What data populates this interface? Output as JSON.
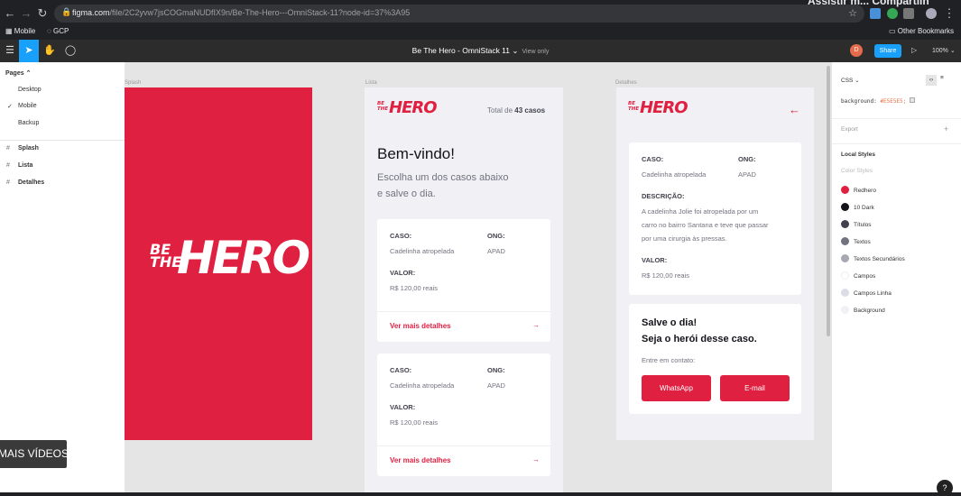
{
  "browser": {
    "url_host": "figma.com",
    "url_path": "/file/2C2yvw7jsCOGmaNUDfIX9n/Be-The-Hero---OmniStack-11?node-id=37%3A95",
    "top_right_text": "Assistir m...       Compartilh",
    "bookmarks": [
      "Mobile",
      "GCP"
    ],
    "other_bookmarks": "Other Bookmarks"
  },
  "figma": {
    "title": "Be The Hero - OmniStack 11",
    "title_mode": "View only",
    "avatar_letter": "D",
    "share_label": "Share",
    "zoom": "100%"
  },
  "pages_panel": {
    "header": "Pages",
    "pages": [
      {
        "label": "Desktop",
        "current": false
      },
      {
        "label": "Mobile",
        "current": true
      },
      {
        "label": "Backup",
        "current": false
      }
    ],
    "frames": [
      "Splash",
      "Lista",
      "Detalhes"
    ],
    "checkmark": "✓",
    "hash": "#"
  },
  "canvas": {
    "labels": {
      "splash": "Splash",
      "lista": "Lista",
      "detalhes": "Detalhes"
    },
    "logo_small": {
      "be": "BE",
      "the": "THE",
      "hero": "HERO"
    },
    "lista": {
      "total_prefix": "Total de ",
      "total_count": "43 casos",
      "welcome": "Bem-vindo!",
      "subtitle_1": "Escolha um dos casos abaixo",
      "subtitle_2": "e salve o dia.",
      "cards": [
        {
          "caso_label": "CASO:",
          "caso": "Cadelinha atropelada",
          "ong_label": "ONG:",
          "ong": "APAD",
          "valor_label": "VALOR:",
          "valor": "R$ 120,00 reais",
          "link": "Ver mais detalhes"
        },
        {
          "caso_label": "CASO:",
          "caso": "Cadelinha atropelada",
          "ong_label": "ONG:",
          "ong": "APAD",
          "valor_label": "VALOR:",
          "valor": "R$ 120,00 reais",
          "link": "Ver mais detalhes"
        }
      ]
    },
    "detalhes": {
      "caso_label": "CASO:",
      "caso": "Cadelinha atropelada",
      "ong_label": "ONG:",
      "ong": "APAD",
      "descricao_label": "DESCRIÇÃO:",
      "descricao_1": "A cadelinha Jolie foi atropelada por um",
      "descricao_2": "carro no bairro Santana e teve que passar",
      "descricao_3": "por uma cirurgia às pressas.",
      "valor_label": "VALOR:",
      "valor": "R$ 120,00 reais",
      "salve_1": "Salve o dia!",
      "salve_2": "Seja o herói desse caso.",
      "contato": "Entre em contato:",
      "whatsapp": "WhatsApp",
      "email": "E-mail"
    }
  },
  "inspect_panel": {
    "mode": "CSS",
    "code_prop": "background:",
    "code_value": "#E5E5E5;",
    "export_label": "Export",
    "local_styles": "Local Styles",
    "color_styles": "Color Styles",
    "styles": [
      {
        "name": "Redhero",
        "color": "#e02041"
      },
      {
        "name": "10 Dark",
        "color": "#13131a"
      },
      {
        "name": "Títulos",
        "color": "#41414d"
      },
      {
        "name": "Textos",
        "color": "#737380"
      },
      {
        "name": "Textos Secundários",
        "color": "#a8a8b3"
      },
      {
        "name": "Campos",
        "color": "#ffffff"
      },
      {
        "name": "Campos Linha",
        "color": "#dcdce6"
      },
      {
        "name": "Background",
        "color": "#f0f0f5"
      }
    ]
  },
  "overlay": {
    "mais_videos": "MAIS VÍDEOS",
    "help": "?"
  },
  "colors": {
    "accent": "#18a0fb",
    "brand": "#e02041",
    "canvas": "#e5e5e5"
  }
}
